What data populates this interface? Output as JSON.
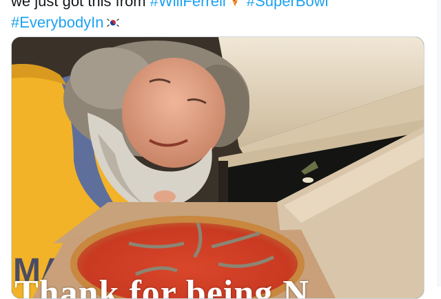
{
  "tweet": {
    "line1_text": "we just got this from ",
    "hashtag_willferrell": "#WillFerrell",
    "hashtag_superbowl": "#SuperBowl",
    "hashtag_everybodyin": "#EverybodyIn",
    "pizza_emoji": "pizza-emoji-icon",
    "flag_emoji": "korean-flag-emoji-icon"
  },
  "media": {
    "caption": "Thank for being N",
    "alt": "Bearded man in yellow shirt smiling next to an open pizza box with anchovy pizza"
  },
  "colors": {
    "text": "#14171a",
    "hashtag": "#1da1f2",
    "border": "#ccd6dd"
  }
}
